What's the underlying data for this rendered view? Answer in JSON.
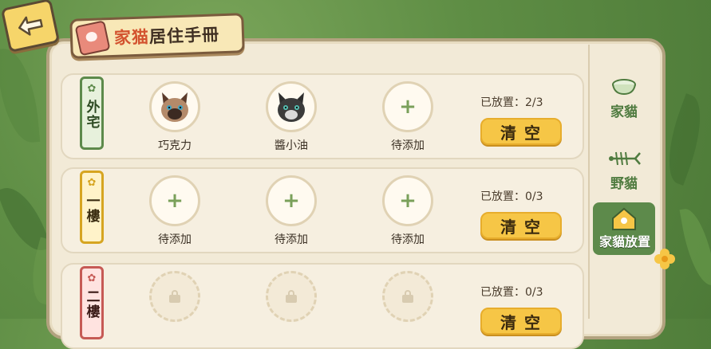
{
  "header": {
    "title_part1": "家猫",
    "title_part2": "居住手冊"
  },
  "rows": [
    {
      "tag": "外宅",
      "slots": [
        {
          "label": "巧克力",
          "state": "cat"
        },
        {
          "label": "醬小油",
          "state": "cat"
        },
        {
          "label": "待添加",
          "state": "empty"
        }
      ],
      "status": "已放置：2/3",
      "clear_label": "清空"
    },
    {
      "tag": "一樓",
      "slots": [
        {
          "label": "待添加",
          "state": "empty"
        },
        {
          "label": "待添加",
          "state": "empty"
        },
        {
          "label": "待添加",
          "state": "empty"
        }
      ],
      "status": "已放置：0/3",
      "clear_label": "清空"
    },
    {
      "tag": "二樓",
      "slots": [
        {
          "label": "",
          "state": "locked"
        },
        {
          "label": "",
          "state": "locked"
        },
        {
          "label": "",
          "state": "locked"
        }
      ],
      "status": "已放置：0/3",
      "clear_label": "清空"
    }
  ],
  "sidebar": {
    "tabs": [
      {
        "label": "家貓",
        "icon": "cat-bowl-icon"
      },
      {
        "label": "野貓",
        "icon": "fish-bone-icon"
      },
      {
        "label": "家貓放置",
        "icon": "house-icon",
        "active": true
      }
    ]
  },
  "colors": {
    "accent": "#f6c646",
    "green": "#5d8a4b",
    "panel": "#f2ead7"
  }
}
